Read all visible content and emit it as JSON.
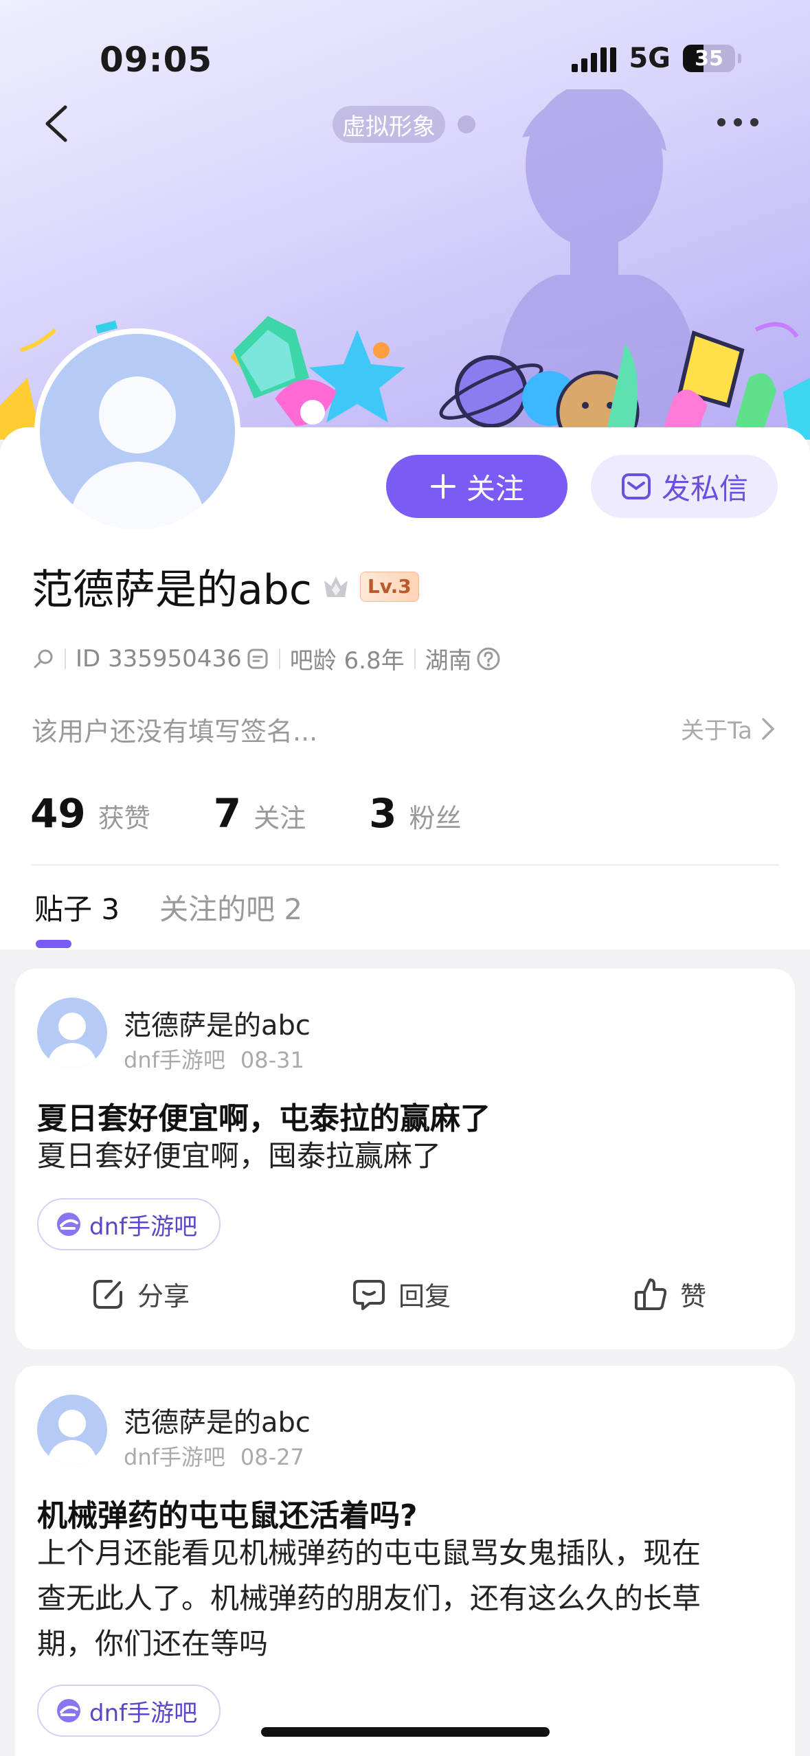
{
  "status_bar": {
    "time": "09:05",
    "network": "5G",
    "battery": "35"
  },
  "header": {
    "avatar_mode_label": "虚拟形象"
  },
  "profile": {
    "username": "范德萨是的abc",
    "level": "Lv.3",
    "id_text": "ID 335950436",
    "bar_age": "吧龄 6.8年",
    "location": "湖南",
    "signature": "该用户还没有填写签名...",
    "about_label": "关于Ta",
    "follow_button": "关注",
    "dm_button": "发私信"
  },
  "stats": [
    {
      "value": "49",
      "label": "获赞"
    },
    {
      "value": "7",
      "label": "关注"
    },
    {
      "value": "3",
      "label": "粉丝"
    }
  ],
  "tabs": [
    {
      "label": "贴子 3"
    },
    {
      "label": "关注的吧 2"
    }
  ],
  "posts": [
    {
      "author": "范德萨是的abc",
      "bar": "dnf手游吧",
      "date": "08-31",
      "title": "夏日套好便宜啊，屯泰拉的赢麻了",
      "body": "夏日套好便宜啊，囤泰拉赢麻了",
      "tag": "dnf手游吧",
      "actions": {
        "share": "分享",
        "reply": "回复",
        "like": "赞"
      }
    },
    {
      "author": "范德萨是的abc",
      "bar": "dnf手游吧",
      "date": "08-27",
      "title": "机械弹药的屯屯鼠还活着吗?",
      "body_lines": [
        "上个月还能看见机械弹药的屯屯鼠骂女鬼插队，现在",
        "查无此人了。机械弹药的朋友们，还有这么久的长草",
        "期，你们还在等吗"
      ],
      "tag": "dnf手游吧"
    }
  ],
  "colors": {
    "accent": "#7a5cf5",
    "accent_light": "#eeeaff",
    "background": "#f2f2f5"
  }
}
